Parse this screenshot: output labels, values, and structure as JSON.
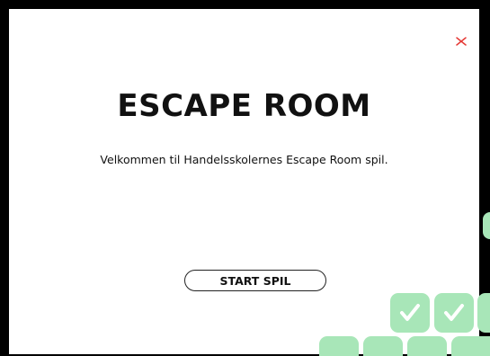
{
  "modal": {
    "title": "ESCAPE ROOM",
    "welcome_text": "Velkommen til Handelsskolernes Escape Room spil.",
    "start_button_label": "START SPIL",
    "close_icon": "close-icon"
  },
  "decoration": {
    "icon": "checkmark-icon",
    "tile_color": "#a8e6b8",
    "check_color": "#ffffff"
  },
  "colors": {
    "backdrop": "#000000",
    "modal_bg": "#ffffff",
    "text": "#111111",
    "close_icon": "#e53935"
  }
}
